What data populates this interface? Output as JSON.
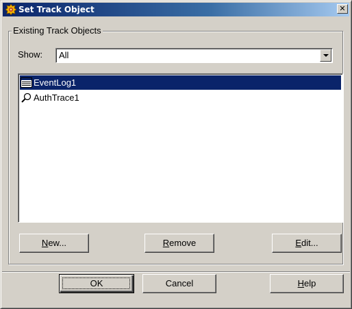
{
  "window": {
    "title": "Set Track Object",
    "close_glyph": "✕"
  },
  "group": {
    "legend": "Existing Track Objects"
  },
  "show": {
    "label": "Show:",
    "value": "All"
  },
  "list": {
    "items": [
      {
        "label": "EventLog1",
        "icon": "event-log-icon",
        "selected": true
      },
      {
        "label": "AuthTrace1",
        "icon": "magnifier-icon",
        "selected": false
      }
    ]
  },
  "list_buttons": {
    "new": {
      "mnemonic": "N",
      "rest": "ew..."
    },
    "remove": {
      "mnemonic": "R",
      "rest": "emove"
    },
    "edit": {
      "mnemonic": "E",
      "rest": "dit..."
    }
  },
  "dialog_buttons": {
    "ok": "OK",
    "cancel": "Cancel",
    "help": {
      "mnemonic": "H",
      "rest": "elp"
    }
  },
  "colors": {
    "face": "#d4d0c8",
    "selection": "#0a246a",
    "titlebar_start": "#0a246a",
    "titlebar_end": "#a6caf0"
  }
}
